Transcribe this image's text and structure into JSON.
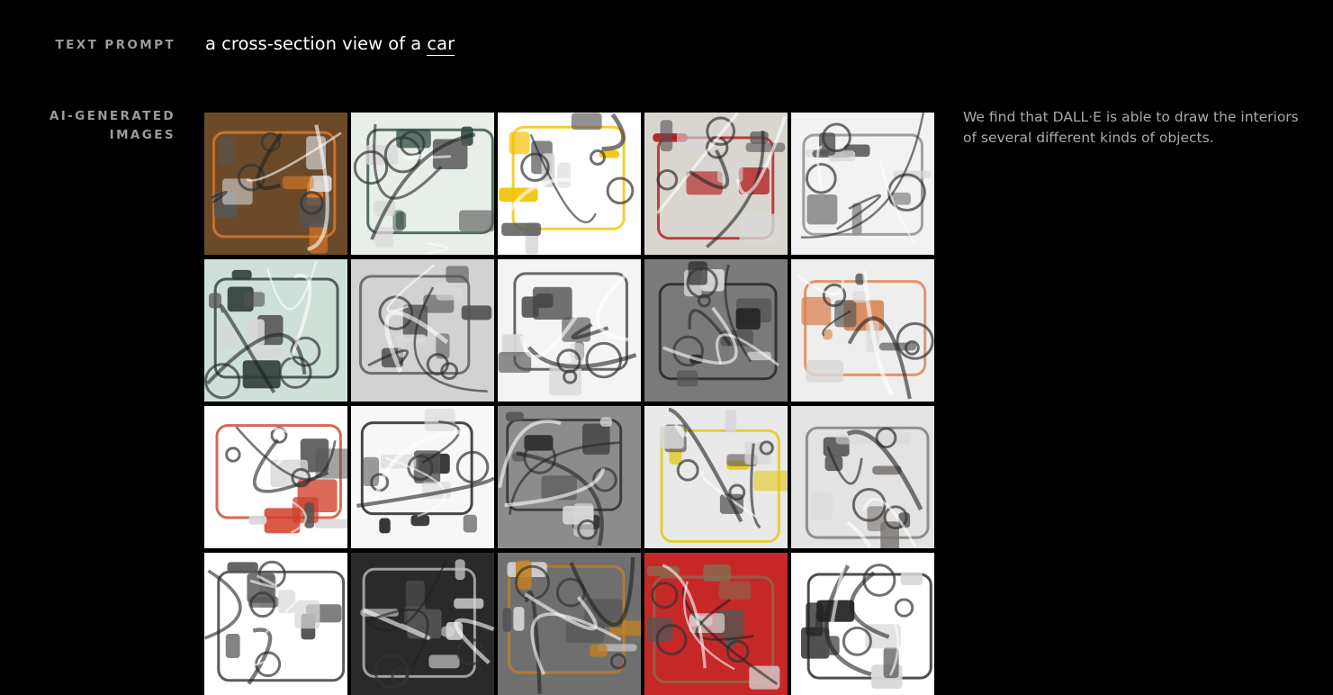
{
  "labels": {
    "text_prompt": "TEXT PROMPT",
    "ai_images_line1": "AI-GENERATED",
    "ai_images_line2": "IMAGES"
  },
  "prompt": {
    "prefix": "a cross-section view of a ",
    "keyword": "car"
  },
  "caption": "We find that DALL·E is able to draw the interiors of several different kinds of objects.",
  "images": [
    {
      "desc": "engine-bay-orange",
      "bg": "#6b4a2a",
      "accent": "#e07a2a"
    },
    {
      "desc": "car-hood-green",
      "bg": "#e8eee8",
      "accent": "#2f4f45"
    },
    {
      "desc": "chassis-gray-yellow",
      "bg": "#ffffff",
      "accent": "#f2c200"
    },
    {
      "desc": "car-top-red",
      "bg": "#d9d6d0",
      "accent": "#b01818"
    },
    {
      "desc": "engine-white",
      "bg": "#f2f2f2",
      "accent": "#8a8a8a"
    },
    {
      "desc": "engine-teal",
      "bg": "#cfe0d8",
      "accent": "#2d3a36"
    },
    {
      "desc": "car-front-gray",
      "bg": "#d2d2d2",
      "accent": "#555555"
    },
    {
      "desc": "interior-white",
      "bg": "#f4f4f4",
      "accent": "#444444"
    },
    {
      "desc": "engine-dark",
      "bg": "#7a7a7a",
      "accent": "#222222"
    },
    {
      "desc": "engine-orange-cutaway",
      "bg": "#eeeeee",
      "accent": "#d9804a"
    },
    {
      "desc": "red-seat-parts",
      "bg": "#ffffff",
      "accent": "#d2402a"
    },
    {
      "desc": "wheel-chassis",
      "bg": "#f7f7f7",
      "accent": "#1b1b1b"
    },
    {
      "desc": "engine-silver",
      "bg": "#8c8c8c",
      "accent": "#2a2a2a"
    },
    {
      "desc": "engine-wheels-yellow",
      "bg": "#e9e9e9",
      "accent": "#e2c80a"
    },
    {
      "desc": "car-frame-silver",
      "bg": "#e3e3e3",
      "accent": "#7a7570"
    },
    {
      "desc": "engine-block-bw",
      "bg": "#ffffff",
      "accent": "#333333"
    },
    {
      "desc": "dark-interior",
      "bg": "#2a2a2a",
      "accent": "#bdbdbd"
    },
    {
      "desc": "seats-dark",
      "bg": "#6f6f6f",
      "accent": "#c08020"
    },
    {
      "desc": "red-engine",
      "bg": "#c62828",
      "accent": "#8a6a50"
    },
    {
      "desc": "car-outline",
      "bg": "#ffffff",
      "accent": "#222222"
    }
  ]
}
